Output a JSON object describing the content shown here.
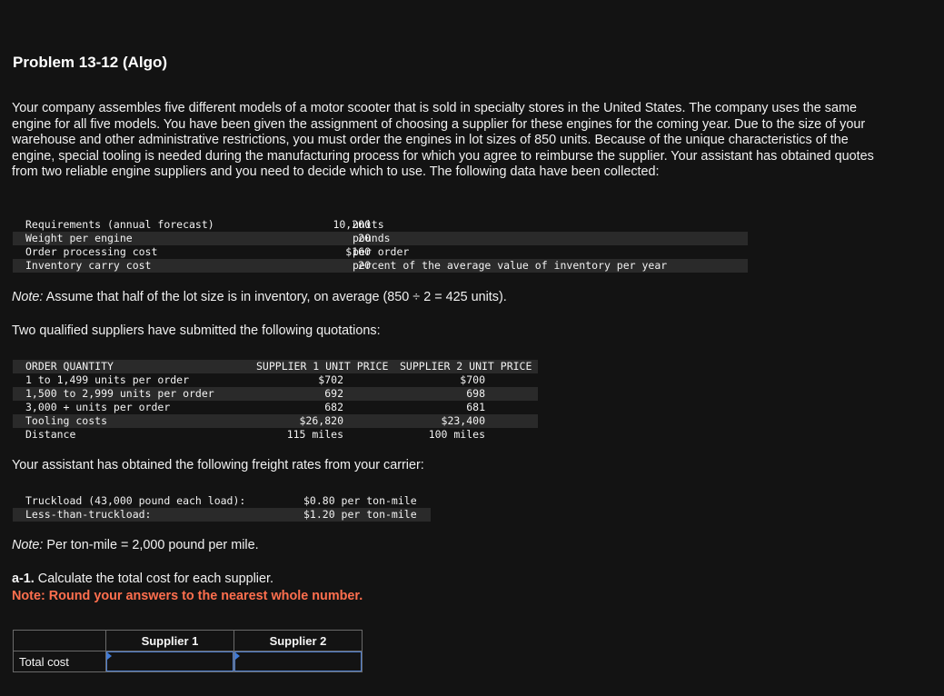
{
  "problem": {
    "title": "Problem 13-12 (Algo)",
    "intro": "Your company assembles five different models of a motor scooter that is sold in specialty stores in the United States. The company uses the same engine for all five models. You have been given the assignment of choosing a supplier for these engines for the coming year. Due to the size of your warehouse and other administrative restrictions, you must order the engines in lot sizes of 850 units. Because of the unique characteristics of the engine, special tooling is needed during the manufacturing process for which you agree to reimburse the supplier. Your assistant has obtained quotes from two reliable engine suppliers and you need to decide which to use. The following data have been collected:"
  },
  "requirements": [
    {
      "label": "Requirements (annual forecast)",
      "value": "10,200",
      "unit": "units"
    },
    {
      "label": "Weight per engine",
      "value": "20",
      "unit": "pounds"
    },
    {
      "label": "Order processing cost",
      "value": "$160",
      "unit": "per order"
    },
    {
      "label": "Inventory carry cost",
      "value": "20",
      "unit": "percent of the average value of inventory per year"
    }
  ],
  "note1": {
    "prefix": "Note:",
    "text": " Assume that half of the lot size is in inventory, on average (850 ÷ 2 = 425 units)."
  },
  "quotes_intro": "Two qualified suppliers have submitted the following quotations:",
  "quotes": {
    "headers": [
      "ORDER QUANTITY",
      "SUPPLIER 1 UNIT PRICE",
      "SUPPLIER 2 UNIT PRICE"
    ],
    "rows": [
      [
        "1 to 1,499 units per order",
        "$702",
        "$700"
      ],
      [
        "1,500 to 2,999 units per order",
        "692",
        "698"
      ],
      [
        "3,000 + units per order",
        "682",
        "681"
      ],
      [
        "Tooling costs",
        "$26,820",
        "$23,400"
      ],
      [
        "Distance",
        "115 miles",
        "100 miles"
      ]
    ]
  },
  "freight_intro": "Your assistant has obtained the following freight rates from your carrier:",
  "freight": [
    {
      "label": "Truckload (43,000 pound each load):",
      "value": "$0.80 per ton-mile"
    },
    {
      "label": "Less-than-truckload:",
      "value": "$1.20 per ton-mile"
    }
  ],
  "note2": {
    "prefix": "Note:",
    "text": " Per ton-mile = 2,000 pound per mile."
  },
  "question": {
    "number": "a-1.",
    "text": " Calculate the total cost for each supplier.",
    "note": "Note: Round your answers to the nearest whole number."
  },
  "answer_table": {
    "headers": [
      "Supplier 1",
      "Supplier 2"
    ],
    "row_label": "Total cost",
    "supplier1_value": "",
    "supplier2_value": ""
  },
  "colors": {
    "background": "#131313",
    "note_accent": "#ff6f4e",
    "input_border": "#4f7fd0"
  }
}
